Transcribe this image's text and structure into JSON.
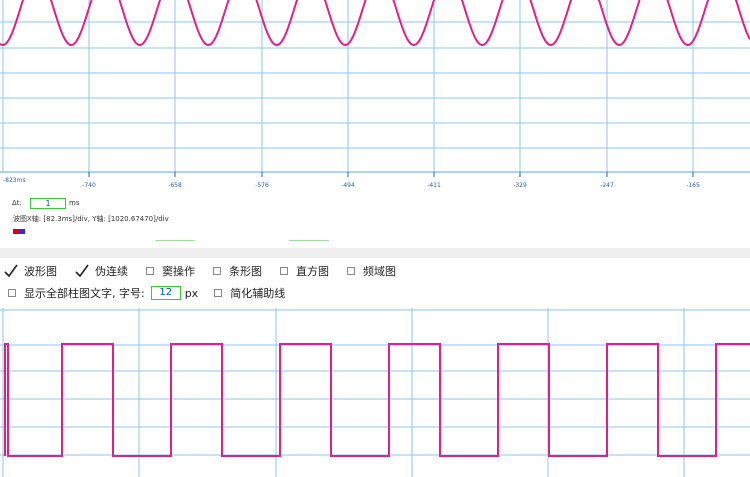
{
  "top_chart": {
    "x_origin_label": "-823ms",
    "x_ticks": [
      "-740",
      "-658",
      "-576",
      "-494",
      "-411",
      "-329",
      "-247",
      "-165"
    ],
    "wave_color": "#e0208a",
    "grid_color": "#8ec5ef"
  },
  "info": {
    "dt_label": "Δt:",
    "dt_value": "1",
    "dt_unit": "ms",
    "scale_text": "波图X轴: [82.3ms]/div, Y轴: [1020.67470]/div"
  },
  "controls": {
    "row1": [
      {
        "label": "波形图",
        "checked": true
      },
      {
        "label": "伪连续",
        "checked": true
      },
      {
        "label": "窦操作",
        "checked": false
      },
      {
        "label": "条形图",
        "checked": false
      },
      {
        "label": "直方图",
        "checked": false
      },
      {
        "label": "频域图",
        "checked": false
      }
    ],
    "show_all_label": "显示全部柱图文字, 字号:",
    "font_size_value": "12",
    "font_size_unit": "px",
    "simplify_label": "简化辅助线"
  },
  "bottom_chart": {
    "wave_color": "#e0208a",
    "grid_color": "#8ec5ef"
  }
}
